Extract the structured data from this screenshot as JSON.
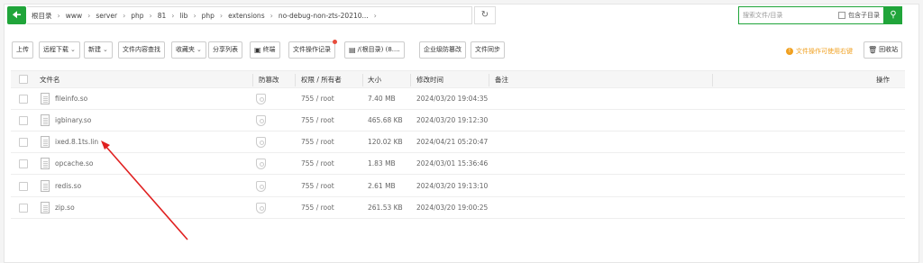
{
  "path": {
    "back_icon": "arrow-left-icon",
    "crumbs": [
      "根目录",
      "www",
      "server",
      "php",
      "81",
      "lib",
      "php",
      "extensions",
      "no-debug-non-zts-20210..."
    ],
    "refresh_icon": "refresh-icon"
  },
  "search": {
    "placeholder": "搜索文件/目录",
    "include_sub_label": "包含子目录",
    "search_icon": "search-icon"
  },
  "toolbar": {
    "upload": "上传",
    "remote_download": "远程下载",
    "new": "新建",
    "content_search": "文件内容查找",
    "favorites": "收藏夹",
    "share_list": "分享列表",
    "terminal": "终端",
    "op_log": "文件操作记录",
    "disk": "/(根目录) (8....",
    "tamper": "企业级防篡改",
    "sync": "文件同步",
    "hint": "文件操作可使用右键",
    "recycle": "回收站"
  },
  "table": {
    "headers": {
      "name": "文件名",
      "tamper": "防篡改",
      "perm": "权限 / 所有者",
      "size": "大小",
      "mtime": "修改时间",
      "note": "备注",
      "ops": "操作"
    },
    "rows": [
      {
        "name": "fileinfo.so",
        "perm": "755 / root",
        "size": "7.40 MB",
        "mtime": "2024/03/20 19:04:35"
      },
      {
        "name": "igbinary.so",
        "perm": "755 / root",
        "size": "465.68 KB",
        "mtime": "2024/03/20 19:12:30"
      },
      {
        "name": "ixed.8.1ts.lin",
        "perm": "755 / root",
        "size": "120.02 KB",
        "mtime": "2024/04/21 05:20:47"
      },
      {
        "name": "opcache.so",
        "perm": "755 / root",
        "size": "1.83 MB",
        "mtime": "2024/03/01 15:36:46"
      },
      {
        "name": "redis.so",
        "perm": "755 / root",
        "size": "2.61 MB",
        "mtime": "2024/03/20 19:13:10"
      },
      {
        "name": "zip.so",
        "perm": "755 / root",
        "size": "261.53 KB",
        "mtime": "2024/03/20 19:00:25"
      }
    ]
  },
  "colors": {
    "accent": "#20a53a",
    "annotation_arrow": "#e02020",
    "hint": "#f0a020"
  }
}
